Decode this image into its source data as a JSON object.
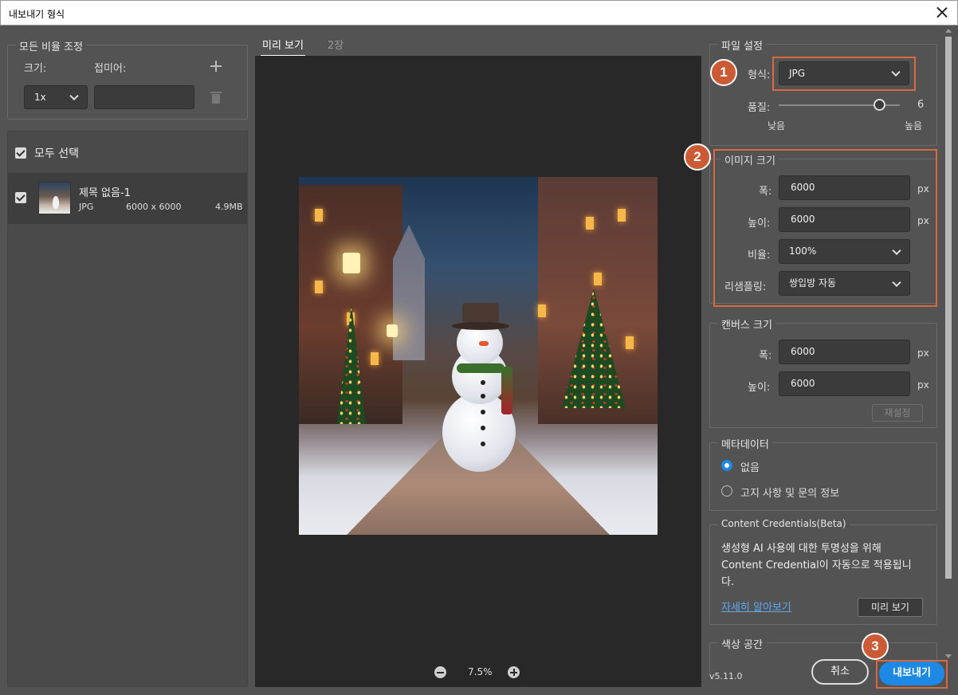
{
  "window": {
    "title": "내보내기 형식"
  },
  "scale": {
    "legend": "모든 비율 조정",
    "size_label": "크기:",
    "suffix_label": "접미어:",
    "size_value": "1x",
    "suffix_value": ""
  },
  "files": {
    "select_all": "모두 선택",
    "items": [
      {
        "name": "제목 없음-1",
        "format": "JPG",
        "dimensions": "6000 x 6000",
        "size": "4.9MB"
      }
    ]
  },
  "preview": {
    "tabs": [
      "미리 보기",
      "2장"
    ],
    "zoom": "7.5%"
  },
  "file_settings": {
    "legend": "파일 설정",
    "format_label": "형식:",
    "format_value": "JPG",
    "quality_label": "품질:",
    "quality_value": "6",
    "quality_min_label": "낮음",
    "quality_max_label": "높음",
    "quality_fraction": 0.83
  },
  "image_size": {
    "legend": "이미지 크기",
    "width_label": "폭:",
    "width_value": "6000",
    "height_label": "높이:",
    "height_value": "6000",
    "ratio_label": "비율:",
    "ratio_value": "100%",
    "resample_label": "리샘플링:",
    "resample_value": "쌍입방 자동",
    "unit": "px"
  },
  "canvas_size": {
    "legend": "캔버스 크기",
    "width_label": "폭:",
    "width_value": "6000",
    "height_label": "높이:",
    "height_value": "6000",
    "unit": "px",
    "reset_label": "재설정"
  },
  "metadata": {
    "legend": "메타데이터",
    "options": [
      "없음",
      "고지 사항 및 문의 정보"
    ],
    "selected": "없음"
  },
  "credentials": {
    "legend": "Content Credentials(Beta)",
    "text_line1": "생성형 AI 사용에 대한 투명성을 위해",
    "text_line2": "Content Credential이 자동으로 적용됩니",
    "text_line3": "다.",
    "learn_more": "자세히 알아보기",
    "preview_button": "미리 보기"
  },
  "color_space": {
    "legend": "색상 공간"
  },
  "footer": {
    "version": "v5.11.0",
    "cancel": "취소",
    "export": "내보내기"
  },
  "badges": [
    "1",
    "2",
    "3"
  ],
  "colors": {
    "accent": "#1e88e5",
    "highlight": "#d9683f",
    "badge": "#cc5a35",
    "link": "#60a8f0"
  }
}
